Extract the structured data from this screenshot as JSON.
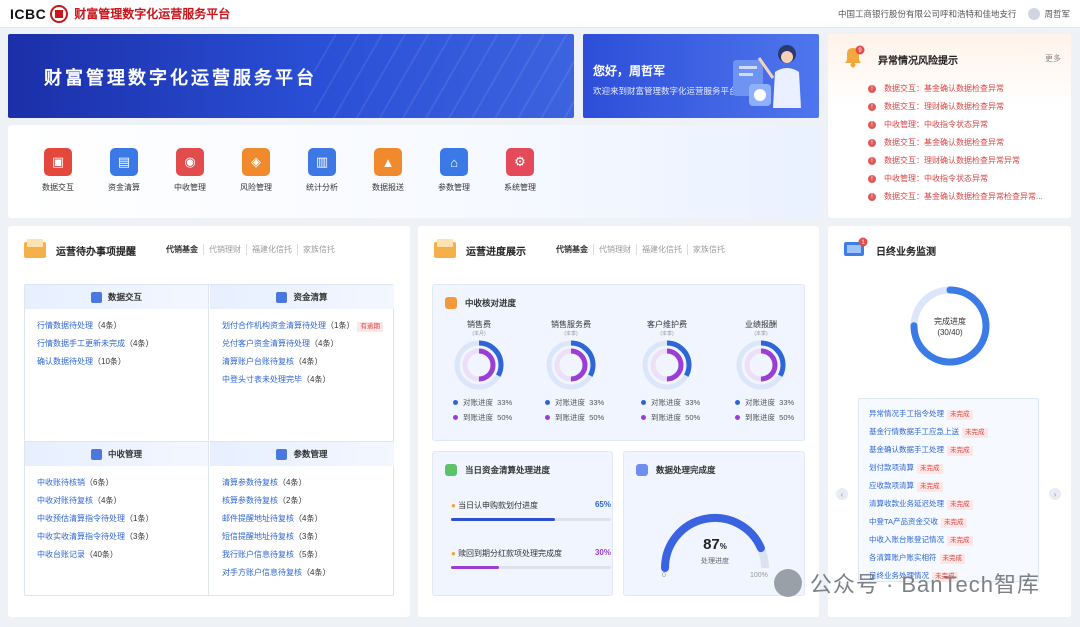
{
  "topbar": {
    "logo": "ICBC",
    "system_name": "财富管理数字化运营服务平台",
    "org": "中国工商银行股份有限公司呼和浩特和佳地支行",
    "user": "周哲军"
  },
  "banner": {
    "title": "财富管理数字化运营服务平台"
  },
  "welcome": {
    "hello": "您好，周哲军",
    "subtitle": "欢迎来到财富管理数字化运营服务平台"
  },
  "nav": [
    {
      "label": "数据交互",
      "color": "#e4483d",
      "icon": "person-icon"
    },
    {
      "label": "资金清算",
      "color": "#3b7ae6",
      "icon": "ledger-icon"
    },
    {
      "label": "中收管理",
      "color": "#e24c4c",
      "icon": "coin-icon"
    },
    {
      "label": "风险管理",
      "color": "#f08a2c",
      "icon": "shield-icon"
    },
    {
      "label": "统计分析",
      "color": "#3d78e4",
      "icon": "chart-icon"
    },
    {
      "label": "数据报送",
      "color": "#f08a2c",
      "icon": "upload-icon"
    },
    {
      "label": "参数管理",
      "color": "#3b7ae6",
      "icon": "bank-icon"
    },
    {
      "label": "系统管理",
      "color": "#e44a5a",
      "icon": "gear-icon"
    }
  ],
  "alerts": {
    "title": "异常情况风险提示",
    "more": "更多",
    "badge": "9",
    "items": [
      "数据交互：基金确认数据检查异常",
      "数据交互：理财确认数据检查异常",
      "中收管理：中收指令状态异常",
      "数据交互：基金确认数据检查异常",
      "数据交互：理财确认数据检查异常异常",
      "中收管理：中收指令状态异常",
      "数据交互：基金确认数据检查异常检查异常..."
    ]
  },
  "todo": {
    "title": "运营待办事项提醒",
    "tabs": [
      "代销基金",
      "代销理财",
      "福建化信托",
      "家族信托"
    ],
    "sections": [
      {
        "title": "数据交互",
        "items": [
          {
            "text": "行情数据待处理",
            "count": "（4条）"
          },
          {
            "text": "行情数据手工更新未完成",
            "count": "（4条）"
          },
          {
            "text": "确认数据待处理",
            "count": "（10条）"
          }
        ]
      },
      {
        "title": "资金清算",
        "items": [
          {
            "text": "划付合作机构资金清算待处理",
            "count": "（1条）",
            "tag": "有逾期"
          },
          {
            "text": "兑付客户资金清算待处理",
            "count": "（4条）"
          },
          {
            "text": "清算账户台账待复核",
            "count": "（4条）"
          },
          {
            "text": "中登头寸表未处理完毕",
            "count": "（4条）"
          }
        ]
      },
      {
        "title": "中收管理",
        "items": [
          {
            "text": "中收账待核销",
            "count": "（6条）"
          },
          {
            "text": "中收对账待复核",
            "count": "（4条）"
          },
          {
            "text": "中收预估清算指令待处理",
            "count": "（1条）"
          },
          {
            "text": "中收实收清算指令待处理",
            "count": "（3条）"
          },
          {
            "text": "中收台账记录",
            "count": "（40条）"
          }
        ]
      },
      {
        "title": "参数管理",
        "items": [
          {
            "text": "清算参数待复核",
            "count": "（4条）"
          },
          {
            "text": "核算参数待复核",
            "count": "（2条）"
          },
          {
            "text": "邮件提醒地址待复核",
            "count": "（4条）"
          },
          {
            "text": "短信提醒地址待复核",
            "count": "（3条）"
          },
          {
            "text": "我行账户信息待复核",
            "count": "（5条）"
          },
          {
            "text": "对手方账户信息待复核",
            "count": "（4条）"
          }
        ]
      }
    ]
  },
  "progress": {
    "title": "运营进度展示",
    "tabs": [
      "代销基金",
      "代销理财",
      "福建化信托",
      "家族信托"
    ],
    "fee": {
      "title": "中收核对进度",
      "legend1": "对账进度",
      "legend2": "到账进度",
      "items": [
        {
          "name": "销售费",
          "sub": "(本月)",
          "v1": "33%",
          "v2": "50%"
        },
        {
          "name": "销售服务费",
          "sub": "(本季)",
          "v1": "33%",
          "v2": "50%"
        },
        {
          "name": "客户维护费",
          "sub": "(本季)",
          "v1": "33%",
          "v2": "50%"
        },
        {
          "name": "业绩报酬",
          "sub": "(本季)",
          "v1": "33%",
          "v2": "50%"
        }
      ],
      "pct1": 0.33,
      "pct2": 0.5
    },
    "clearing": {
      "title": "当日资金清算处理进度",
      "rows": [
        {
          "label": "当日认申购款划付进度",
          "value": "65%",
          "pct": 0.65
        },
        {
          "label": "赎回到期分红款项处理完成度",
          "value": "30%",
          "pct": 0.3
        }
      ]
    },
    "data": {
      "title": "数据处理完成度",
      "value": "87",
      "unit": "%",
      "label": "处理进度",
      "min": "0",
      "max": "100%",
      "pct": 0.87
    }
  },
  "daily": {
    "title": "日终业务监测",
    "badge": "1",
    "ring_label": "完成进度",
    "ring_value": "(30/40)",
    "pct": 0.75,
    "items": [
      {
        "text": "异常情况手工指令处理",
        "tag": "未完成"
      },
      {
        "text": "基金行情数据手工应急上送",
        "tag": "未完成"
      },
      {
        "text": "基金确认数据手工处理",
        "tag": "未完成"
      },
      {
        "text": "划付款项清算",
        "tag": "未完成"
      },
      {
        "text": "应收款项清算",
        "tag": "未完成"
      },
      {
        "text": "清算收款业务延迟处理",
        "tag": "未完成"
      },
      {
        "text": "中登TA产品资金交收",
        "tag": "未完成"
      },
      {
        "text": "中收入账台账登记情况",
        "tag": "未完成"
      },
      {
        "text": "各清算账户账实相符",
        "tag": "未完成"
      },
      {
        "text": "日终业务处理情况",
        "tag": "未完成"
      }
    ]
  },
  "watermark": {
    "text": "公众号 · BanTech智库"
  },
  "colors": {
    "accent": "#2f66d6",
    "alert": "#d94646",
    "brand": "#c8161d"
  }
}
